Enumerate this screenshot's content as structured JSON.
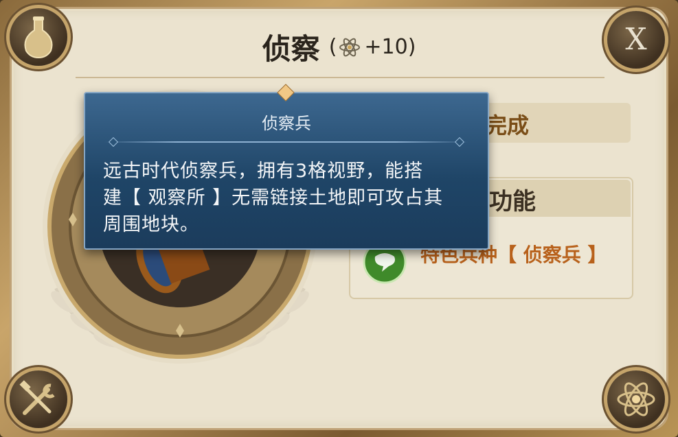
{
  "header": {
    "title": "侦察",
    "bonus_prefix": "(",
    "bonus_value": "+10)",
    "bonus_icon": "atom-icon"
  },
  "buttons": {
    "close_label": "X"
  },
  "corners": {
    "top_left_icon": "flask-icon",
    "bottom_left_icon": "tools-icon",
    "bottom_right_icon": "atom-icon"
  },
  "status": {
    "text": "完成"
  },
  "features": {
    "title": "功能",
    "items": [
      {
        "icon": "speech-bubble-icon",
        "text": "特色兵种【 侦察兵 】"
      }
    ]
  },
  "tooltip": {
    "title": "侦察兵",
    "lines": [
      "远古时代侦察兵，拥有3格视野，能搭",
      "建【 观察所 】无需链接土地即可攻占其",
      "周围地块。"
    ]
  },
  "colors": {
    "panel_bg": "#ebe3cf",
    "frame_gold": "#c5a46a",
    "tooltip_bg": "#1f4567",
    "accent_orange": "#b8611b"
  }
}
